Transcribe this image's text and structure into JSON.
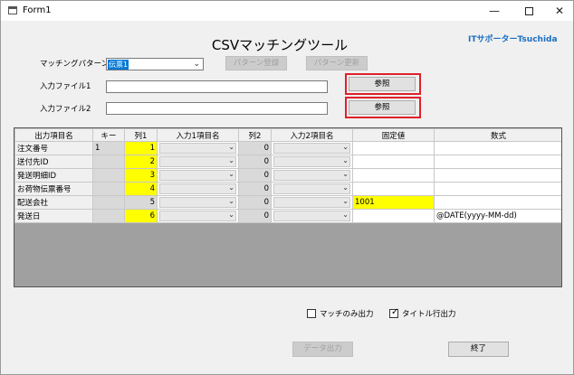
{
  "window": {
    "title": "Form1",
    "min_glyph": "—",
    "close_glyph": "✕"
  },
  "header": {
    "title": "CSVマッチングツール",
    "brand": "ITサポーターTsuchida"
  },
  "form": {
    "pattern_label": "マッチングパターン",
    "pattern_value": "伝票1",
    "pattern_register": "パターン登録",
    "pattern_update": "パターン更新",
    "file1_label": "入力ファイル1",
    "file1_value": "",
    "file1_browse": "参照",
    "file2_label": "入力ファイル2",
    "file2_value": "",
    "file2_browse": "参照"
  },
  "grid": {
    "headers": [
      "出力項目名",
      "キー",
      "列1",
      "入力1項目名",
      "列2",
      "入力2項目名",
      "固定値",
      "数式"
    ],
    "rows": [
      {
        "name": "注文番号",
        "key": "1",
        "col1": "1",
        "col1_yellow": true,
        "in1": "",
        "col2": "0",
        "in2": "",
        "fixed": "",
        "fixed_yellow": false,
        "formula": ""
      },
      {
        "name": "送付先ID",
        "key": "",
        "col1": "2",
        "col1_yellow": true,
        "in1": "",
        "col2": "0",
        "in2": "",
        "fixed": "",
        "fixed_yellow": false,
        "formula": ""
      },
      {
        "name": "発送明細ID",
        "key": "",
        "col1": "3",
        "col1_yellow": true,
        "in1": "",
        "col2": "0",
        "in2": "",
        "fixed": "",
        "fixed_yellow": false,
        "formula": ""
      },
      {
        "name": "お荷物伝票番号",
        "key": "",
        "col1": "4",
        "col1_yellow": true,
        "in1": "",
        "col2": "0",
        "in2": "",
        "fixed": "",
        "fixed_yellow": false,
        "formula": ""
      },
      {
        "name": "配送会社",
        "key": "",
        "col1": "5",
        "col1_yellow": false,
        "in1": "",
        "col2": "0",
        "in2": "",
        "fixed": "1001",
        "fixed_yellow": true,
        "formula": ""
      },
      {
        "name": "発送日",
        "key": "",
        "col1": "6",
        "col1_yellow": true,
        "in1": "",
        "col2": "0",
        "in2": "",
        "fixed": "",
        "fixed_yellow": false,
        "formula": "@DATE(yyyy-MM-dd)"
      }
    ]
  },
  "options": {
    "match_only_label": "マッチのみ出力",
    "match_only_checked": false,
    "title_row_label": "タイトル行出力",
    "title_row_checked": true
  },
  "footer": {
    "export_label": "データ出力",
    "exit_label": "終了"
  }
}
